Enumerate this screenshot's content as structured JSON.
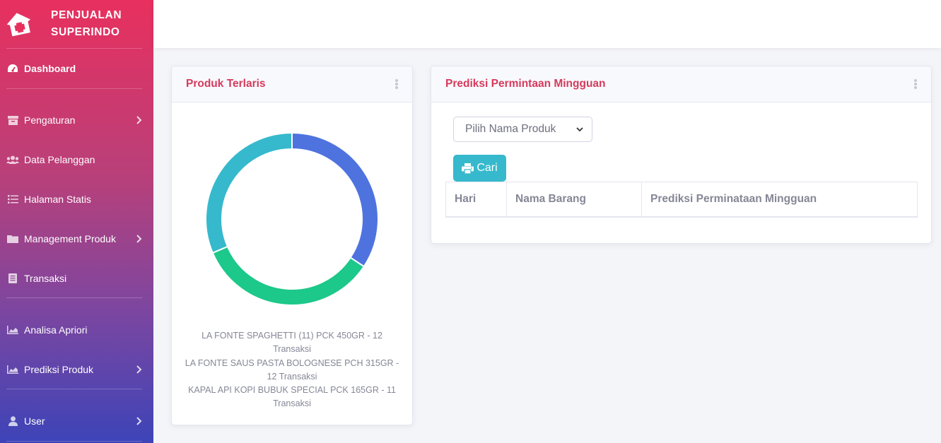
{
  "brand": {
    "line1": "PENJUALAN",
    "line2": "SUPERINDO",
    "icon": "house-medical-icon"
  },
  "sidebar": {
    "items": [
      {
        "label": "Dashboard",
        "icon": "dashboard-gauge-icon",
        "active": true,
        "chevron": false
      },
      {
        "label": "Pengaturan",
        "icon": "archive-box-icon",
        "chevron": true
      },
      {
        "label": "Data Pelanggan",
        "icon": "users-icon",
        "chevron": false
      },
      {
        "label": "Halaman Statis",
        "icon": "list-icon",
        "chevron": false
      },
      {
        "label": "Management Produk",
        "icon": "folder-icon",
        "chevron": true
      },
      {
        "label": "Transaksi",
        "icon": "receipt-icon",
        "chevron": false
      },
      {
        "label": "Analisa Apriori",
        "icon": "area-chart-icon",
        "chevron": false
      },
      {
        "label": "Prediksi Produk",
        "icon": "area-chart-icon",
        "chevron": true
      },
      {
        "label": "User",
        "icon": "user-icon",
        "chevron": true
      }
    ]
  },
  "produk_terlaris": {
    "title": "Produk Terlaris",
    "legend": [
      "LA FONTE SPAGHETTI (11) PCK 450GR - 12 Transaksi",
      "LA FONTE SAUS PASTA BOLOGNESE PCH 315GR - 12 Transaksi",
      "KAPAL API KOPI BUBUK SPECIAL PCK 165GR - 11 Transaksi"
    ]
  },
  "chart_data": {
    "type": "pie",
    "donut": true,
    "title": "",
    "categories": [
      "LA FONTE SPAGHETTI (11) PCK 450GR",
      "LA FONTE SAUS PASTA BOLOGNESE PCH 315GR",
      "KAPAL API KOPI BUBUK SPECIAL PCK 165GR"
    ],
    "values": [
      12,
      12,
      11
    ],
    "colors": [
      "#4e73df",
      "#1cc88a",
      "#36b9cc"
    ]
  },
  "prediksi": {
    "title": "Prediksi Permintaan Mingguan",
    "select_placeholder": "Pilih Nama Produk",
    "button_label": "Cari",
    "columns": [
      "Hari",
      "Nama Barang",
      "Prediksi Perminataan Mingguan"
    ]
  }
}
